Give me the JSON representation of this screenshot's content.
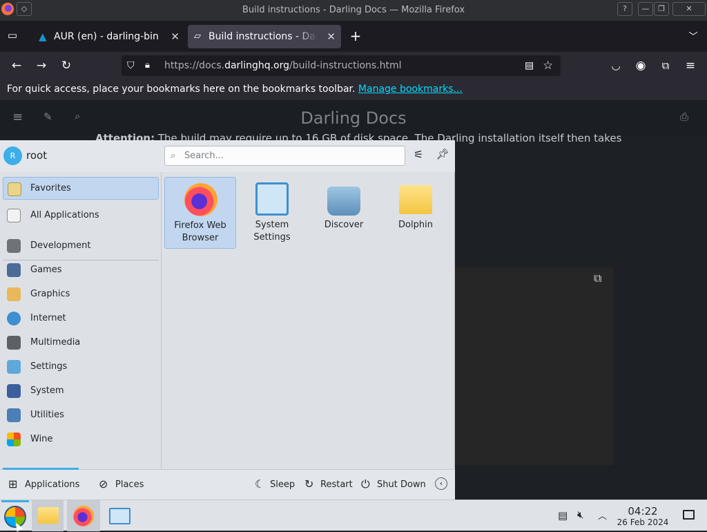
{
  "window": {
    "title": "Build instructions - Darling Docs — Mozilla Firefox"
  },
  "tabs": [
    {
      "label": "AUR (en) - darling-bin"
    },
    {
      "label": "Build instructions - Darling Docs"
    }
  ],
  "address_bar": {
    "url_prefix": "https://docs.",
    "url_domain": "darlinghq.org",
    "url_path": "/build-instructions.html"
  },
  "bookmarks_bar": {
    "message": "For quick access, place your bookmarks here on the bookmarks toolbar.",
    "link": "Manage bookmarks..."
  },
  "page": {
    "site_title": "Darling Docs",
    "body_text_bold": "Attention:",
    "body_text": "The build may require up to 16 GB of disk space. The Darling installation itself then takes"
  },
  "launcher": {
    "user_initial": "R",
    "username": "root",
    "search_placeholder": "Search...",
    "categories": [
      {
        "label": "Favorites"
      },
      {
        "label": "All Applications"
      },
      {
        "label": "Development"
      },
      {
        "label": "Games"
      },
      {
        "label": "Graphics"
      },
      {
        "label": "Internet"
      },
      {
        "label": "Multimedia"
      },
      {
        "label": "Settings"
      },
      {
        "label": "System"
      },
      {
        "label": "Utilities"
      },
      {
        "label": "Wine"
      }
    ],
    "apps": [
      {
        "line1": "Firefox Web",
        "line2": "Browser"
      },
      {
        "line1": "System",
        "line2": "Settings"
      },
      {
        "line1": "Discover",
        "line2": ""
      },
      {
        "line1": "Dolphin",
        "line2": ""
      }
    ],
    "footer": {
      "applications": "Applications",
      "places": "Places",
      "sleep": "Sleep",
      "restart": "Restart",
      "shutdown": "Shut Down"
    }
  },
  "taskbar": {
    "time": "04:22",
    "date": "26 Feb 2024"
  }
}
